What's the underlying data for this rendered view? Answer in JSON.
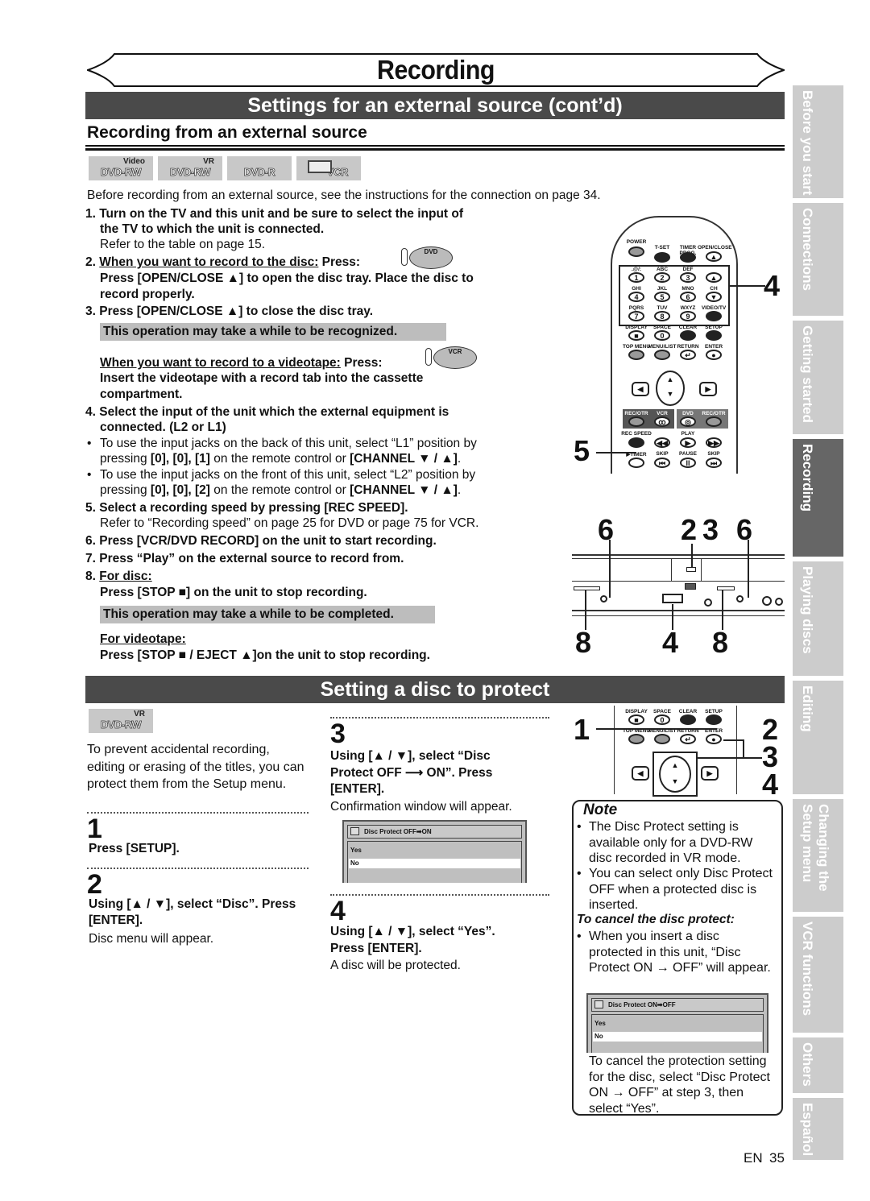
{
  "page": {
    "title": "Recording",
    "page_lang": "EN",
    "page_number": "35"
  },
  "section1": {
    "bar_title": "Settings for an external source (cont’d)",
    "subheading": "Recording from an external source",
    "disc_badges": [
      {
        "top": "Video",
        "main": "DVD-RW",
        "icon": "disc-icon"
      },
      {
        "top": "VR",
        "main": "DVD-RW",
        "icon": "disc-icon"
      },
      {
        "top": "",
        "main": "DVD-R",
        "icon": "disc-icon"
      },
      {
        "top": "",
        "main": "VCR",
        "icon": "vcr-cassette-icon"
      }
    ],
    "intro": "Before recording from an external source, see the instructions for the connection on page 34.",
    "step1_bold_a": "1. Turn on the TV and this unit and be sure to select the input of",
    "step1_bold_b": "the TV to which the unit is connected.",
    "step1_normal": "Refer to the table on page 15.",
    "step2_num": "2.",
    "step2_ul": "When you want to record to the disc:",
    "step2_press": " Press:",
    "step2_btn": "DVD",
    "step2_line2": "Press [OPEN/CLOSE ▲] to open the disc tray. Place the disc to",
    "step2_line3": "record properly.",
    "step3": "3. Press [OPEN/CLOSE ▲] to close the disc tray.",
    "note_recognized": "This operation may take a while to be recognized.",
    "vcr_ul": "When you want to record to a videotape:",
    "vcr_press": " Press:",
    "vcr_btn": "VCR",
    "vcr_line2": "Insert the videotape with a record tab into the cassette",
    "vcr_line3": "compartment.",
    "step4_a": "4. Select the input of the unit which the external equipment is",
    "step4_b": "connected. (L2 or L1)",
    "bullet1_a": "To use the input jacks on the back of this unit, select “L1” position by",
    "bullet1_b_pre": "pressing ",
    "bullet1_b_keys": "[0], [0], [1]",
    "bullet1_b_mid": " on the remote control or  ",
    "bullet1_b_ch": "[CHANNEL ▼ / ▲]",
    "bullet1_b_end": ".",
    "bullet2_a": "To use the input jacks on the front of this unit, select “L2” position by",
    "bullet2_b_pre": "pressing ",
    "bullet2_b_keys": "[0], [0], [2]",
    "bullet2_b_mid": " on the remote control or ",
    "bullet2_b_ch": "[CHANNEL ▼ / ▲]",
    "bullet2_b_end": ".",
    "step5_bold": "5. Select a recording speed by pressing [REC SPEED].",
    "step5_normal": "Refer to “Recording speed” on page 25 for DVD or page 75 for VCR.",
    "step6": "6. Press [VCR/DVD RECORD] on the unit to start recording.",
    "step7": "7. Press “Play” on the external source to record from.",
    "step8_num": "8.",
    "step8_disc_ul": "For disc:",
    "step8_disc_text": "Press [STOP ■] on the unit to stop recording.",
    "note_completed": "This operation may take a while to be completed.",
    "step8_tape_ul": "For videotape:",
    "step8_tape_text": "Press [STOP ■ / EJECT ▲]on the unit to stop recording."
  },
  "remote_top": {
    "row1": [
      "POWER",
      "T-SET",
      "TIMER PROG.",
      "OPEN/CLOSE"
    ],
    "row2_letters": [
      ".@/:",
      "ABC",
      "DEF"
    ],
    "row2_keys": [
      "1",
      "2",
      "3"
    ],
    "row3_letters": [
      "GHI",
      "JKL",
      "MNO"
    ],
    "row3_keys": [
      "4",
      "5",
      "6"
    ],
    "ch_label": "CH",
    "row4_letters": [
      "PQRS",
      "TUV",
      "WXYZ",
      "VIDEO/TV"
    ],
    "row4_keys": [
      "7",
      "8",
      "9"
    ],
    "row5": [
      "DISPLAY",
      "SPACE",
      "CLEAR",
      "SETUP"
    ],
    "row5_keys": [
      "■",
      "0"
    ],
    "row6": [
      "TOP MENU",
      "MENU/LIST",
      "RETURN",
      "ENTER"
    ],
    "row7": [
      "REC/OTR",
      "VCR",
      "DVD",
      "REC/OTR"
    ],
    "row8": [
      "REC SPEED",
      "",
      "PLAY",
      ""
    ],
    "row9": [
      "▶TIMER",
      "SKIP",
      "PAUSE",
      "SKIP"
    ],
    "callouts": {
      "keypad": "4",
      "rec_speed": "5"
    }
  },
  "front_panel": {
    "callouts_top": [
      "6",
      "2",
      "3",
      "6"
    ],
    "callouts_bottom": [
      "8",
      "4",
      "8"
    ]
  },
  "section2": {
    "bar_title": "Setting a disc to protect",
    "disc_badge": {
      "top": "VR",
      "main": "DVD-RW"
    },
    "intro": "To prevent accidental recording, editing or erasing of the titles, you can protect them from the Setup menu.",
    "steps": [
      {
        "num": "1",
        "bold": "Press [SETUP].",
        "normal": ""
      },
      {
        "num": "2",
        "bold": "Using [▲ / ▼], select “Disc”. Press [ENTER].",
        "normal": "Disc menu will appear."
      },
      {
        "num": "3",
        "bold": "Using [▲ / ▼], select “Disc Protect OFF ⟶ ON”. Press [ENTER].",
        "normal": "Confirmation window will appear."
      },
      {
        "num": "4",
        "bold": "Using [▲ / ▼], select “Yes”. Press [ENTER].",
        "normal": "A disc will be protected."
      }
    ],
    "screen1": {
      "title": "Disc Protect OFF➡ON",
      "options": [
        "Yes",
        "No"
      ],
      "selected": "No"
    },
    "remote_labels": {
      "row1": [
        "DISPLAY",
        "SPACE",
        "CLEAR",
        "SETUP"
      ],
      "row2": [
        "TOP MENU",
        "MENU/LIST",
        "RETURN",
        "ENTER"
      ],
      "callouts_left": "1",
      "callouts_right": [
        "2",
        "3",
        "4"
      ]
    },
    "note": {
      "heading": "Note",
      "bullets": [
        "The Disc Protect setting is available only for a DVD-RW disc recorded in VR mode.",
        "You can select only Disc Protect OFF when a protected disc is inserted."
      ],
      "cancel_heading": "To cancel the disc protect:",
      "cancel_bullet": "When you insert a disc protected in this unit, “Disc Protect ON → OFF” will appear.",
      "screen2": {
        "title": "Disc Protect ON➡OFF",
        "options": [
          "Yes",
          "No"
        ],
        "selected": "No"
      },
      "footer": "To cancel the protection setting for the disc, select “Disc Protect ON → OFF” at step 3, then select “Yes”."
    }
  },
  "sidebar_tabs": [
    {
      "label": "Before you start",
      "active": false
    },
    {
      "label": "Connections",
      "active": false
    },
    {
      "label": "Getting started",
      "active": false
    },
    {
      "label": "Recording",
      "active": true
    },
    {
      "label": "Playing discs",
      "active": false
    },
    {
      "label": "Editing",
      "active": false
    },
    {
      "label": "Changing the\nSetup menu",
      "active": false
    },
    {
      "label": "VCR functions",
      "active": false
    },
    {
      "label": "Others",
      "active": false
    },
    {
      "label": "Español",
      "active": false
    }
  ],
  "colors": {
    "section_bar": "#4a4a4a",
    "tab_inactive": "#cccccc",
    "tab_active": "#666666",
    "note_highlight": "#bdbdbd"
  }
}
